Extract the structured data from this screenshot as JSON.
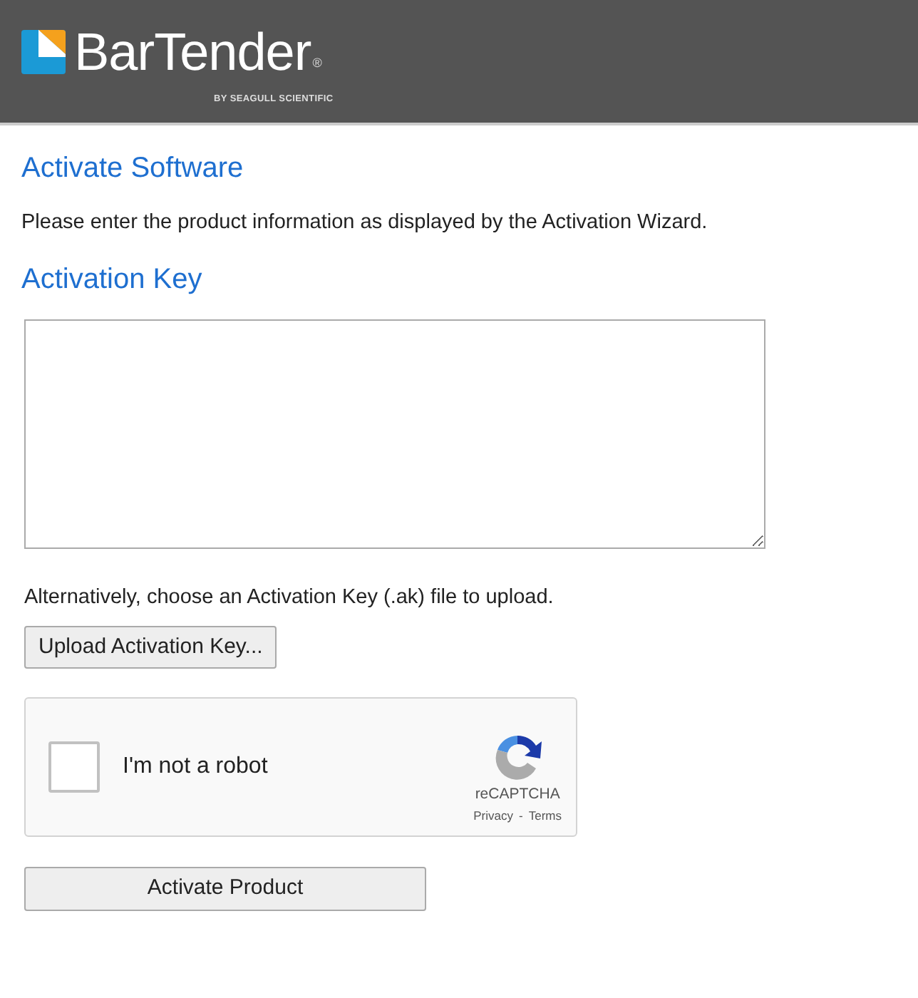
{
  "header": {
    "logo": {
      "name": "BarTender",
      "registered": "®",
      "tagline": "BY SEAGULL SCIENTIFIC"
    }
  },
  "title": "Activate Software",
  "instructions": "Please enter the product information as displayed by the Activation Wizard.",
  "key_label": "Activation Key",
  "alternative_text": "Alternatively, choose an Activation Key (.ak) file to upload.",
  "upload_button": "Upload Activation Key...",
  "captcha": {
    "label": "I'm not a robot",
    "checked": false,
    "brand": "reCAPTCHA",
    "privacy": "Privacy",
    "separator": "-",
    "terms": "Terms"
  },
  "submit_button": "Activate Product"
}
